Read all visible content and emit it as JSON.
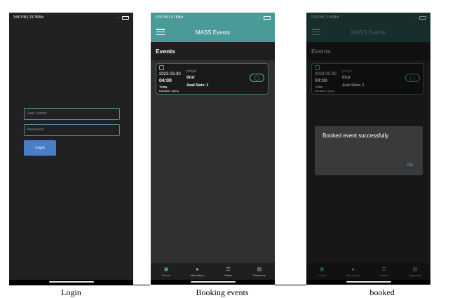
{
  "login_screen": {
    "status": {
      "left": "3:56 PM | 23.7KB/s",
      "right": "…"
    },
    "username_placeholder": "User Name:",
    "password_placeholder": "Password:",
    "login_button": "Login",
    "caption": "Login"
  },
  "booking_screen": {
    "status": {
      "left": "2:26 PM | 0.7KB/s",
      "right": "…"
    },
    "app_title": "MASS Events",
    "section_title": "Events",
    "event": {
      "date": "2023-03-30",
      "time": "04:00",
      "day": "Today",
      "duration": "Duration: 0(hrs)",
      "organizer": "proyal",
      "location": "tirur",
      "slots": "Avail Slots: 3"
    },
    "nav": [
      {
        "label": "Events",
        "icon": "calendar-icon"
      },
      {
        "label": "Attendance",
        "icon": "attendance-icon"
      },
      {
        "label": "Status",
        "icon": "list-icon"
      },
      {
        "label": "Payments",
        "icon": "payment-icon"
      }
    ],
    "caption": "Booking events"
  },
  "booked_screen": {
    "status": {
      "left": "2:26 PM | 3.4KB/s",
      "right": "…"
    },
    "app_title": "MASS Events",
    "section_title": "Events",
    "event": {
      "date": "2023-03-30",
      "time": "04:00",
      "day": "Today",
      "duration": "Duration: 0(hrs)",
      "organizer": "proyal",
      "location": "tirur",
      "slots": "Avail Slots: 2"
    },
    "dialog_message": "Booked event successfully",
    "dialog_ok": "OK",
    "nav": [
      {
        "label": "Events",
        "icon": "calendar-icon"
      },
      {
        "label": "Attendance",
        "icon": "attendance-icon"
      },
      {
        "label": "Status",
        "icon": "list-icon"
      },
      {
        "label": "Payments",
        "icon": "payment-icon"
      }
    ],
    "caption": "booked"
  },
  "colors": {
    "accent": "#4a9a98",
    "login_button": "#4a7ec7",
    "dialog_ok": "#5fb3ff"
  }
}
